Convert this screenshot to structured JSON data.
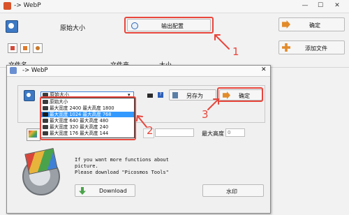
{
  "main": {
    "title": "-> WebP",
    "size_label": "原始大小",
    "output_config_label": "输出配置",
    "ok_label": "确定",
    "add_file_label": "添加文件",
    "list_headers": [
      "文件名",
      "文件夹",
      "大小"
    ]
  },
  "dialog": {
    "title": "-> WebP",
    "select_value": "原始大小",
    "options": [
      "原始大小",
      "最大宽度 2400 最大高度 1800",
      "最大宽度 1024 最大高度 768",
      "最大宽度 640 最大高度 480",
      "最大宽度 320 最大高度 240",
      "最大宽度 176 最大高度 144"
    ],
    "highlighted_option_index": 2,
    "save_as_label": "另存为",
    "ok_label": "确定",
    "max_height_label": "最大高度",
    "max_height_value": "0",
    "info_line1": "If you want more functions about",
    "info_line2": "picture.",
    "info_line3": "Please download \"Picosmos Tools\"",
    "download_label": "Download",
    "watermark_label": "水印"
  },
  "annotations": [
    "1",
    "2",
    "3"
  ],
  "colors": {
    "annotation_red": "#e8463c",
    "highlight_blue": "#3399ff"
  }
}
